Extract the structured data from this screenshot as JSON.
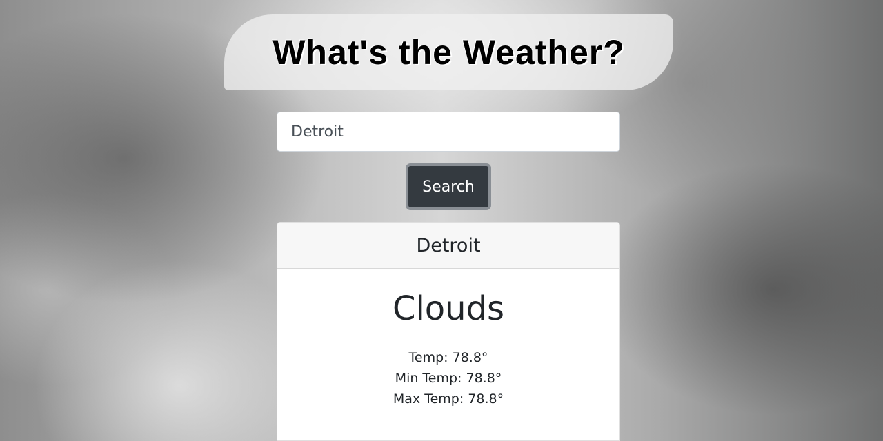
{
  "header": {
    "title": "What's the Weather?"
  },
  "search": {
    "value": "Detroit",
    "placeholder": "",
    "button_label": "Search"
  },
  "weather_card": {
    "city": "Detroit",
    "condition": "Clouds",
    "temp": "Temp: 78.8°",
    "min_temp": "Min Temp: 78.8°",
    "max_temp": "Max Temp: 78.8°"
  },
  "colors": {
    "button_bg": "#343a40",
    "card_header_bg": "#f7f7f7",
    "text": "#212529"
  }
}
